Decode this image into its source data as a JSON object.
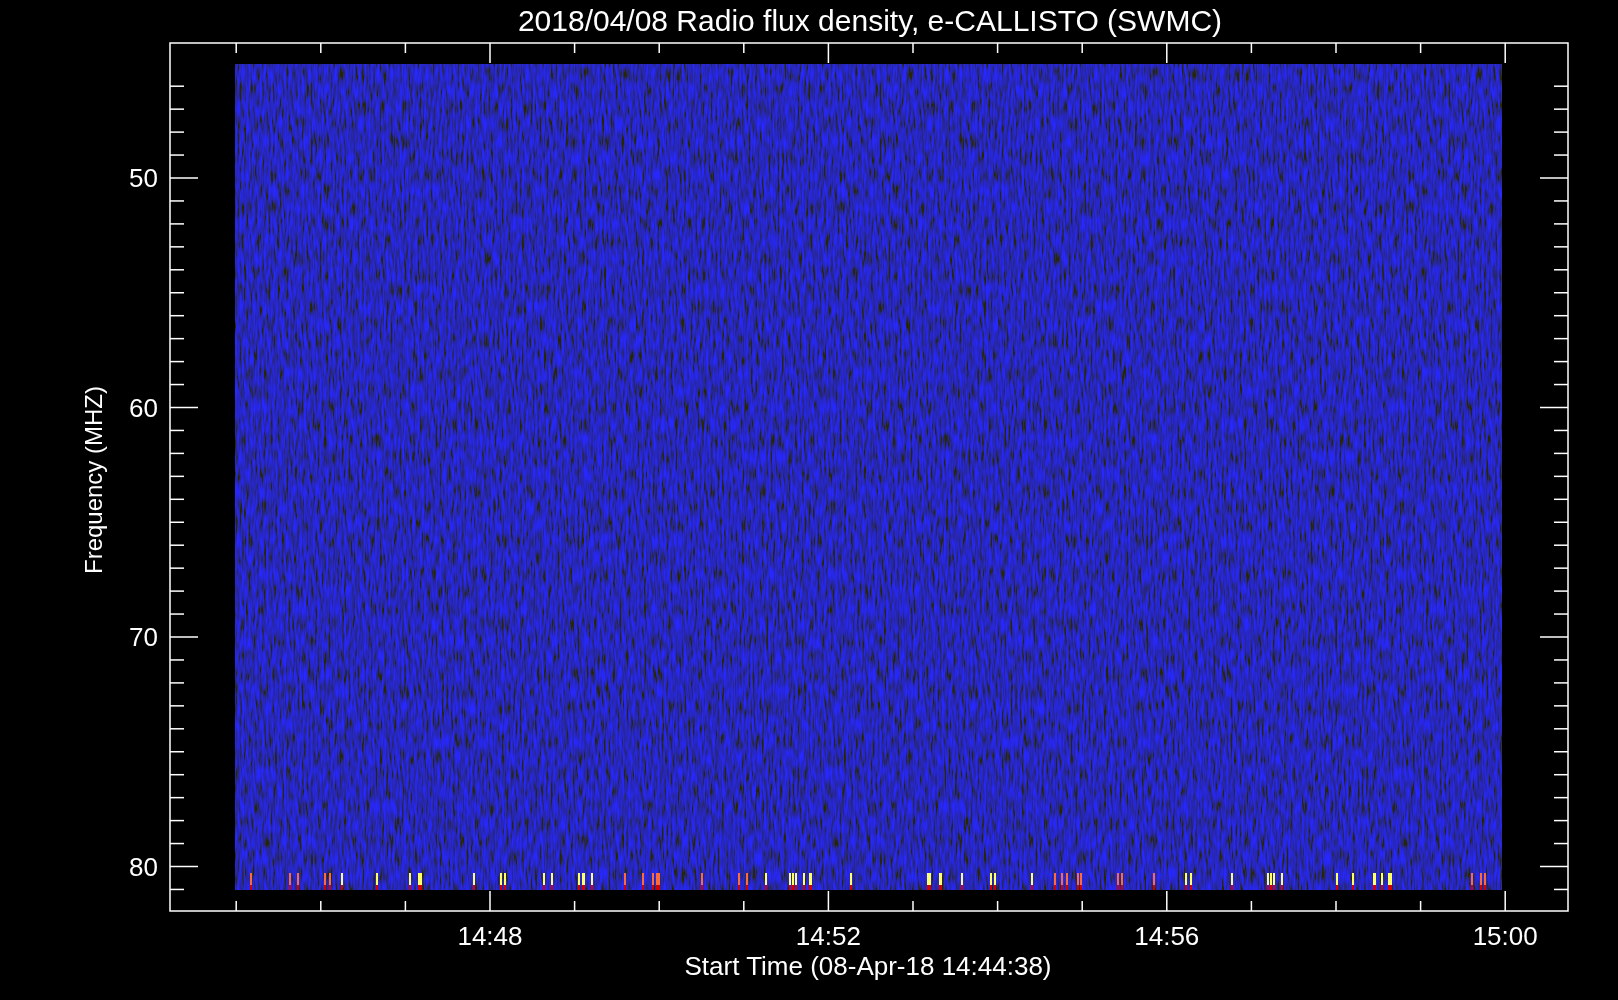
{
  "title": "2018/04/08  Radio flux density, e-CALLISTO (SWMC)",
  "plot": {
    "ylabel": "Frequency (MHZ)",
    "xlabel": "Start Time (08-Apr-18 14:44:38)",
    "yticks": [
      "50",
      "60",
      "70",
      "80"
    ],
    "xticks": [
      "14:48",
      "14:52",
      "14:56",
      "15:00"
    ]
  }
}
